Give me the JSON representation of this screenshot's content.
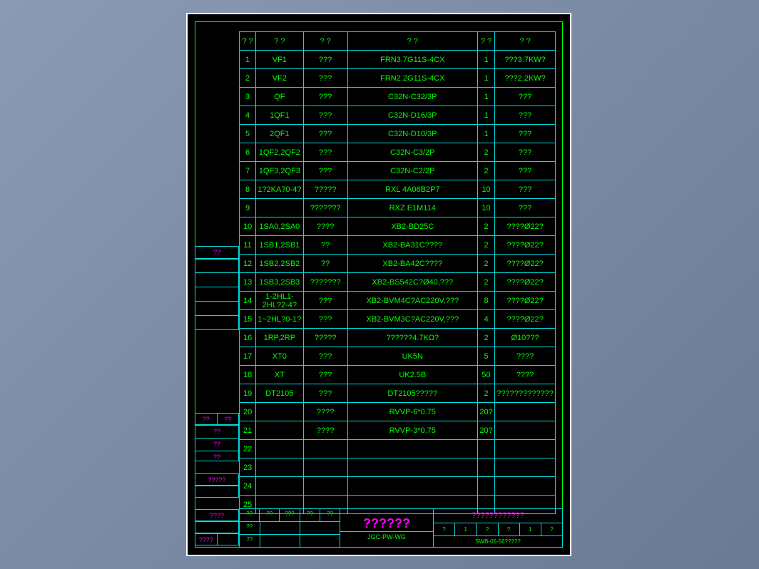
{
  "header": {
    "c1": "? ?",
    "c2": "?   ?",
    "c3": "?    ?",
    "c4": "?        ?",
    "c5": "? ?",
    "c6": "?  ?"
  },
  "rows": [
    {
      "n": "1",
      "code": "VF1",
      "name": "???",
      "spec": "FRN3.7G11S-4CX",
      "qty": "1",
      "note": "???3.7KW?"
    },
    {
      "n": "2",
      "code": "VF2",
      "name": "???",
      "spec": "FRN2.2G11S-4CX",
      "qty": "1",
      "note": "???2.2KW?"
    },
    {
      "n": "3",
      "code": "QF",
      "name": "???",
      "spec": "C32N-C32/3P",
      "qty": "1",
      "note": "???"
    },
    {
      "n": "4",
      "code": "1QF1",
      "name": "???",
      "spec": "C32N-D16/3P",
      "qty": "1",
      "note": "???"
    },
    {
      "n": "5",
      "code": "2QF1",
      "name": "???",
      "spec": "C32N-D10/3P",
      "qty": "1",
      "note": "???"
    },
    {
      "n": "6",
      "code": "1QF2,2QF2",
      "name": "???",
      "spec": "C32N-C3/2P",
      "qty": "2",
      "note": "???"
    },
    {
      "n": "7",
      "code": "1QF3,2QF3",
      "name": "???",
      "spec": "C32N-C2/2P",
      "qty": "2",
      "note": "???"
    },
    {
      "n": "8",
      "code": "1?2KA?0-4?",
      "name": "?????",
      "spec": "RXL 4A06B2P7",
      "qty": "10",
      "note": "???"
    },
    {
      "n": "9",
      "code": "",
      "name": "???????",
      "spec": "RXZ E1M114",
      "qty": "10",
      "note": "???"
    },
    {
      "n": "10",
      "code": "1SA0,2SA0",
      "name": "????",
      "spec": "XB2-BD25C",
      "qty": "2",
      "note": "????Ø22?"
    },
    {
      "n": "11",
      "code": "1SB1,2SB1",
      "name": "??",
      "spec": "XB2-BA31C????",
      "qty": "2",
      "note": "????Ø22?"
    },
    {
      "n": "12",
      "code": "1SB2,2SB2",
      "name": "??",
      "spec": "XB2-BA42C????",
      "qty": "2",
      "note": "????Ø22?"
    },
    {
      "n": "13",
      "code": "1SB3,2SB3",
      "name": "???????",
      "spec": "XB2-BS542C?Ø40,???",
      "qty": "2",
      "note": "????Ø22?"
    },
    {
      "n": "14",
      "code": "1-2HL1-2HL?2-4?",
      "name": "???",
      "spec": "XB2-BVM4C?AC220V,???",
      "qty": "8",
      "note": "????Ø22?"
    },
    {
      "n": "15",
      "code": "1~2HL?0-1?",
      "name": "???",
      "spec": "XB2-BVM3C?AC220V,???",
      "qty": "4",
      "note": "????Ø22?"
    },
    {
      "n": "16",
      "code": "1RP,2RP",
      "name": "?????",
      "spec": "??????4.7KΩ?",
      "qty": "2",
      "note": "Ø10???"
    },
    {
      "n": "17",
      "code": "XT0",
      "name": "???",
      "spec": "UK5N",
      "qty": "5",
      "note": "????"
    },
    {
      "n": "18",
      "code": "XT",
      "name": "???",
      "spec": "UK2.5B",
      "qty": "50",
      "note": "????"
    },
    {
      "n": "19",
      "code": "DT2105",
      "name": "???",
      "spec": "DT2105?????",
      "qty": "2",
      "note": "?????????????"
    },
    {
      "n": "20",
      "code": "",
      "name": "????",
      "spec": "RVVP-6*0.75",
      "qty": "20?",
      "note": ""
    },
    {
      "n": "21",
      "code": "",
      "name": "????",
      "spec": "RVVP-3*0.75",
      "qty": "20?",
      "note": ""
    },
    {
      "n": "22",
      "code": "",
      "name": "",
      "spec": "",
      "qty": "",
      "note": ""
    },
    {
      "n": "23",
      "code": "",
      "name": "",
      "spec": "",
      "qty": "",
      "note": ""
    },
    {
      "n": "24",
      "code": "",
      "name": "",
      "spec": "",
      "qty": "",
      "note": ""
    },
    {
      "n": "25",
      "code": "",
      "name": "",
      "spec": "",
      "qty": "",
      "note": ""
    }
  ],
  "sidelabels": {
    "l0": "??",
    "l1": "??",
    "l2": "??",
    "l3": "?????",
    "l4": "????",
    "l5": "????"
  },
  "title": {
    "main": "??????",
    "code": "JGC-PW-WG",
    "proj": "????????????",
    "dwg": "SWB-05-56?????"
  },
  "tbl": {
    "r1c1": "??",
    "r1c2": "??",
    "r1c3": "???",
    "r1c4": "??",
    "r1c5": "??",
    "r2c1": "??",
    "r2c2": "",
    "r2c3": "",
    "r3c1": "??",
    "r3c2": "",
    "r3c3": ""
  },
  "tbr": {
    "c1": "?",
    "c2": "1",
    "c3": "?",
    "c4": "?",
    "c5": "1",
    "c6": "?"
  }
}
